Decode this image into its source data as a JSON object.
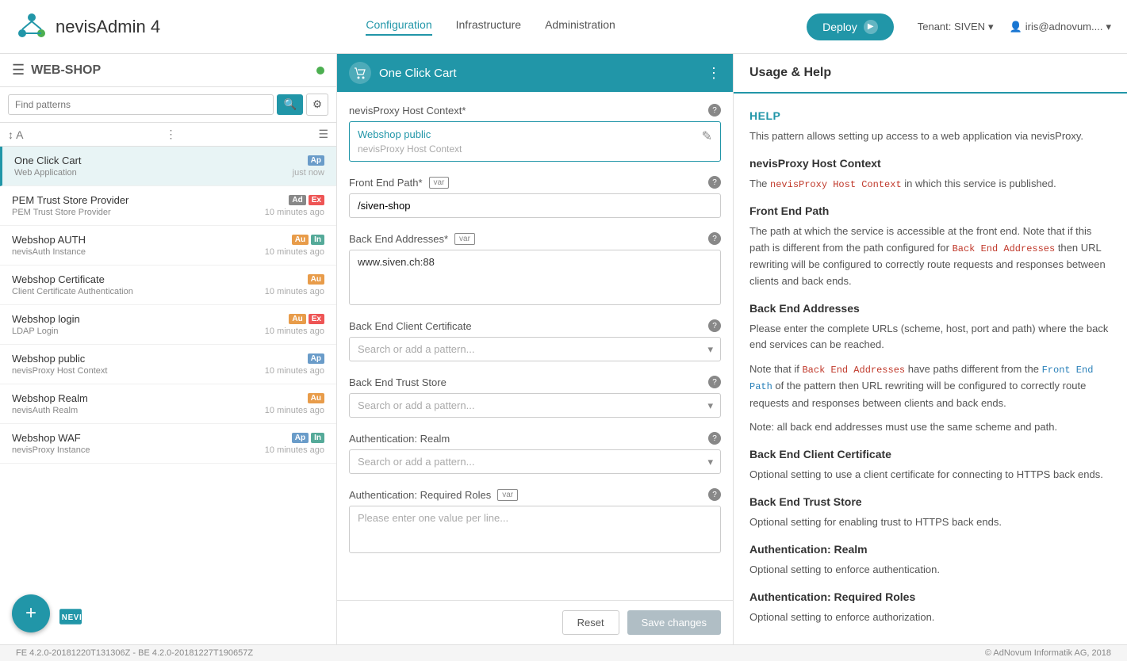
{
  "app": {
    "name": "nevisAdmin 4"
  },
  "nav": {
    "links": [
      {
        "label": "Configuration",
        "active": true
      },
      {
        "label": "Infrastructure",
        "active": false
      },
      {
        "label": "Administration",
        "active": false
      }
    ],
    "deploy_label": "Deploy",
    "tenant_label": "Tenant: SIVEN",
    "user_label": "iris@adnovum...."
  },
  "sidebar": {
    "project_name": "WEB-SHOP",
    "search_placeholder": "Find patterns",
    "items": [
      {
        "name": "One Click Cart",
        "sub": "Web Application",
        "time": "just now",
        "badges": [
          "Ap"
        ],
        "active": true
      },
      {
        "name": "PEM Trust Store Provider",
        "sub": "PEM Trust Store Provider",
        "time": "10 minutes ago",
        "badges": [
          "Ad",
          "Ex"
        ],
        "active": false
      },
      {
        "name": "Webshop AUTH",
        "sub": "nevisAuth Instance",
        "time": "10 minutes ago",
        "badges": [
          "Au",
          "In"
        ],
        "active": false
      },
      {
        "name": "Webshop Certificate",
        "sub": "Client Certificate Authentication",
        "time": "10 minutes ago",
        "badges": [
          "Au"
        ],
        "active": false
      },
      {
        "name": "Webshop login",
        "sub": "LDAP Login",
        "time": "10 minutes ago",
        "badges": [
          "Au",
          "Ex"
        ],
        "active": false
      },
      {
        "name": "Webshop public",
        "sub": "nevisProxy Host Context",
        "time": "10 minutes ago",
        "badges": [
          "Ap"
        ],
        "active": false
      },
      {
        "name": "Webshop Realm",
        "sub": "nevisAuth Realm",
        "time": "10 minutes ago",
        "badges": [
          "Au"
        ],
        "active": false
      },
      {
        "name": "Webshop WAF",
        "sub": "nevisProxy Instance",
        "time": "10 minutes ago",
        "badges": [
          "Ap",
          "In"
        ],
        "active": false
      }
    ]
  },
  "center": {
    "title": "One Click Cart",
    "fields": {
      "nevisProxy_host_context": {
        "label": "nevisProxy Host Context*",
        "link_text": "Webshop public",
        "sub_text": "nevisProxy Host Context"
      },
      "front_end_path": {
        "label": "Front End Path*",
        "value": "/siven-shop",
        "var_badge": "var"
      },
      "back_end_addresses": {
        "label": "Back End Addresses*",
        "value": "www.siven.ch:88",
        "var_badge": "var"
      },
      "back_end_client_certificate": {
        "label": "Back End Client Certificate",
        "placeholder": "Search or add a pattern..."
      },
      "back_end_trust_store": {
        "label": "Back End Trust Store",
        "placeholder": "Search or add a pattern..."
      },
      "authentication_realm": {
        "label": "Authentication: Realm",
        "placeholder": "Search or add a pattern..."
      },
      "authentication_required_roles": {
        "label": "Authentication: Required Roles",
        "placeholder": "Please enter one value per line...",
        "var_badge": "var"
      }
    },
    "footer": {
      "reset_label": "Reset",
      "save_label": "Save changes"
    }
  },
  "help": {
    "title": "Usage & Help",
    "help_label": "HELP",
    "intro": "This pattern allows setting up access to a web application via nevisProxy.",
    "sections": [
      {
        "header": "nevisProxy Host Context",
        "text": "The nevisProxy Host Context in which this service is published."
      },
      {
        "header": "Front End Path",
        "text": "The path at which the service is accessible at the front end. Note that if this path is different from the path configured for Back End Addresses then URL rewriting will be configured to correctly route requests and responses between clients and back ends."
      },
      {
        "header": "Back End Addresses",
        "text": "Please enter the complete URLs (scheme, host, port and path) where the back end services can be reached."
      },
      {
        "header": "",
        "text": "Note that if Back End Addresses have paths different from the Front End Path of the pattern then URL rewriting will be configured to correctly route requests and responses between clients and back ends."
      },
      {
        "header": "",
        "text": "Note: all back end addresses must use the same scheme and path."
      },
      {
        "header": "Back End Client Certificate",
        "text": "Optional setting to use a client certificate for connecting to HTTPS back ends."
      },
      {
        "header": "Back End Trust Store",
        "text": "Optional setting for enabling trust to HTTPS back ends."
      },
      {
        "header": "Authentication: Realm",
        "text": "Optional setting to enforce authentication."
      },
      {
        "header": "Authentication: Required Roles",
        "text": "Optional setting to enforce authorization."
      }
    ]
  },
  "footer": {
    "fe_version": "FE 4.2.0-20181220T131306Z",
    "be_version": "BE 4.2.0-20181227T190657Z",
    "copyright": "© AdNovum Informatik AG, 2018"
  }
}
